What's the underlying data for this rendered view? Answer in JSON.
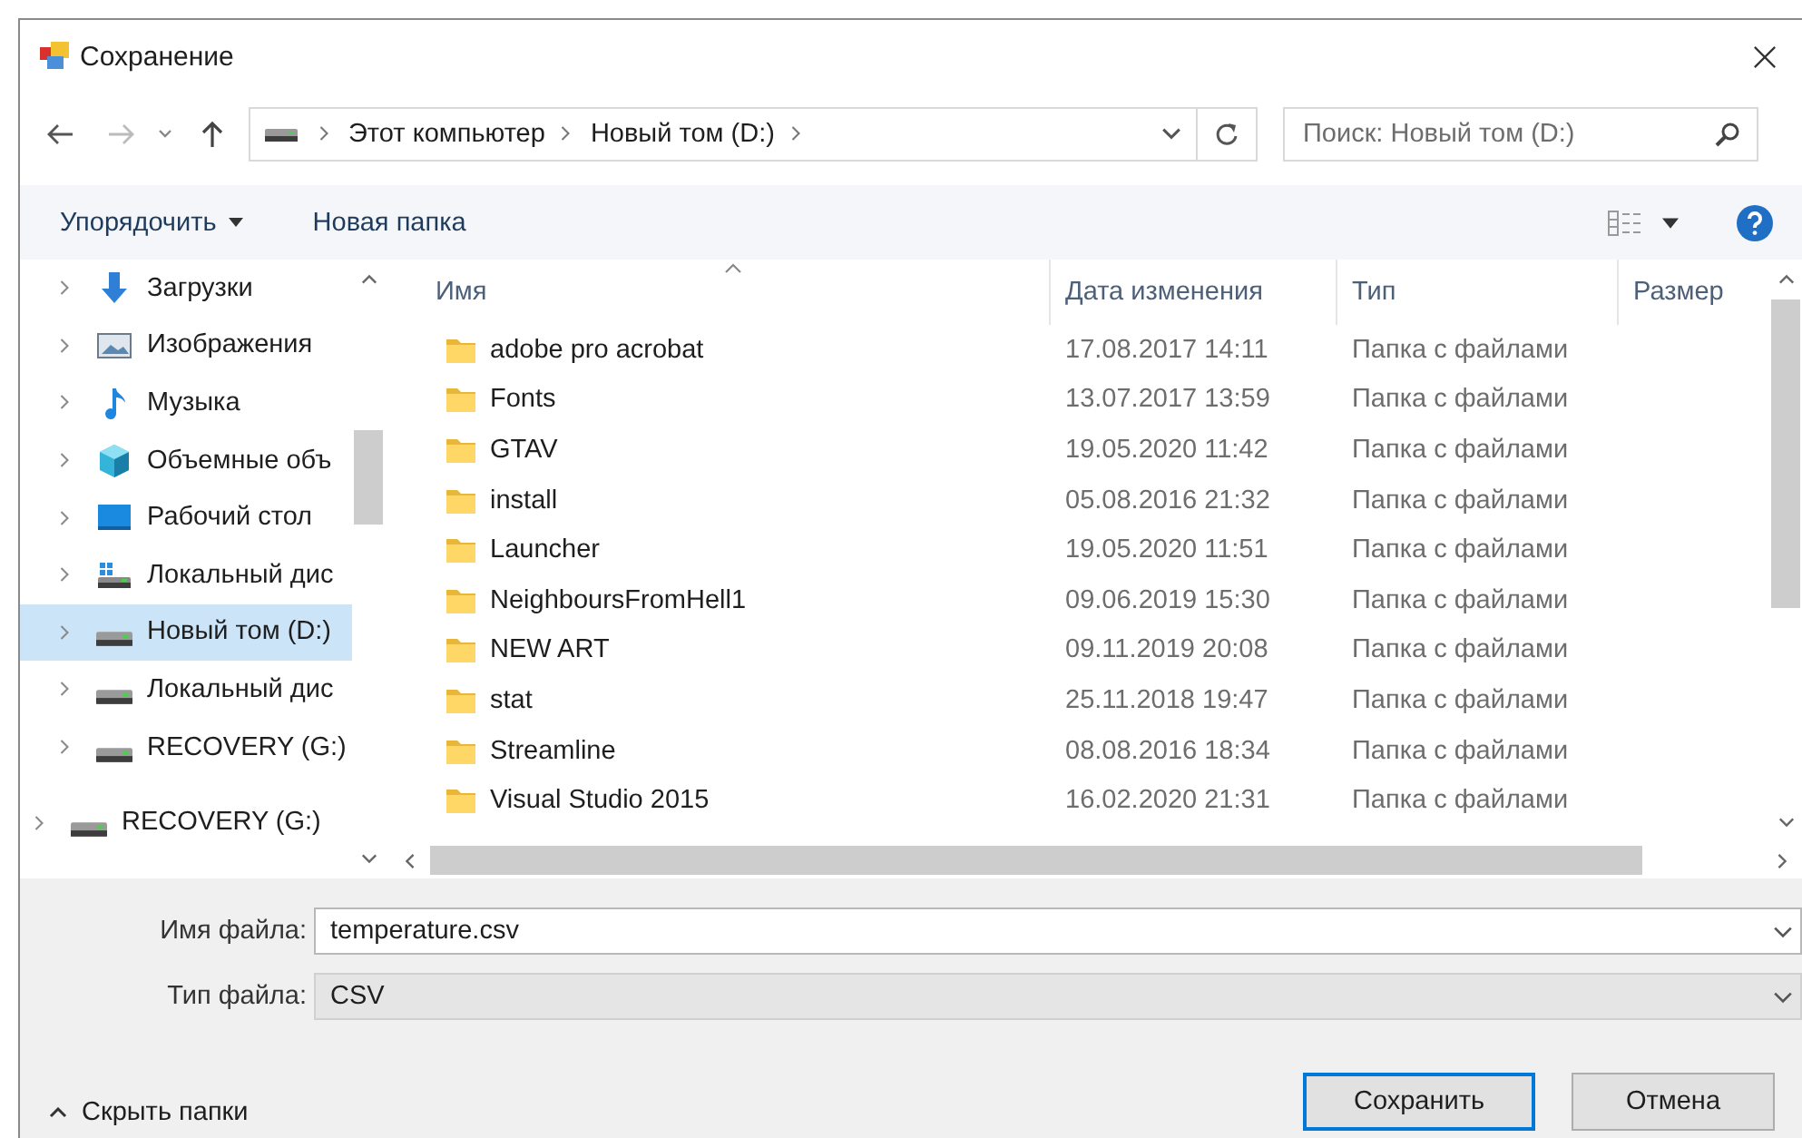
{
  "window": {
    "title": "Сохранение"
  },
  "address_bar": {
    "segments": [
      "Этот компьютер",
      "Новый том (D:)"
    ]
  },
  "search": {
    "placeholder": "Поиск: Новый том (D:)"
  },
  "toolbar": {
    "buttons": [
      {
        "label": "Упорядочить",
        "kind": "menu"
      },
      {
        "label": "Новая папка",
        "kind": "plain"
      }
    ]
  },
  "sidebar": {
    "items": [
      {
        "label": "Загрузки",
        "kind": "downloads",
        "selected": false
      },
      {
        "label": "Изображения",
        "kind": "pictures",
        "selected": false
      },
      {
        "label": "Музыка",
        "kind": "music",
        "selected": false
      },
      {
        "label": "Объемные объ",
        "kind": "objects",
        "selected": false
      },
      {
        "label": "Рабочий стол",
        "kind": "desktop",
        "selected": false
      },
      {
        "label": "Локальный дис",
        "kind": "system-drive",
        "selected": false
      },
      {
        "label": "Новый том (D:)",
        "kind": "drive",
        "selected": true
      },
      {
        "label": "Локальный дис",
        "kind": "drive",
        "selected": false
      },
      {
        "label": "RECOVERY (G:)",
        "kind": "drive",
        "selected": false
      }
    ],
    "root_items": [
      {
        "label": "RECOVERY (G:)",
        "kind": "drive",
        "selected": false
      }
    ]
  },
  "file_list": {
    "columns": [
      {
        "label": "Имя",
        "sorted": true
      },
      {
        "label": "Дата изменения",
        "sorted": false
      },
      {
        "label": "Тип",
        "sorted": false
      },
      {
        "label": "Размер",
        "sorted": false
      }
    ],
    "rows": [
      {
        "name": "adobe pro acrobat",
        "date": "17.08.2017 14:11",
        "type": "Папка с файлами"
      },
      {
        "name": "Fonts",
        "date": "13.07.2017 13:59",
        "type": "Папка с файлами"
      },
      {
        "name": "GTAV",
        "date": "19.05.2020 11:42",
        "type": "Папка с файлами"
      },
      {
        "name": "install",
        "date": "05.08.2016 21:32",
        "type": "Папка с файлами"
      },
      {
        "name": "Launcher",
        "date": "19.05.2020 11:51",
        "type": "Папка с файлами"
      },
      {
        "name": "NeighboursFromHell1",
        "date": "09.06.2019 15:30",
        "type": "Папка с файлами"
      },
      {
        "name": "NEW ART",
        "date": "09.11.2019 20:08",
        "type": "Папка с файлами"
      },
      {
        "name": "stat",
        "date": "25.11.2018 19:47",
        "type": "Папка с файлами"
      },
      {
        "name": "Streamline",
        "date": "08.08.2016 18:34",
        "type": "Папка с файлами"
      },
      {
        "name": "Visual Studio 2015",
        "date": "16.02.2020 21:31",
        "type": "Папка с файлами"
      }
    ]
  },
  "form": {
    "file_name": {
      "label": "Имя файла:",
      "value": "temperature.csv"
    },
    "file_type": {
      "label": "Тип файла:",
      "value": "CSV"
    }
  },
  "hide_folders": "Скрыть папки",
  "buttons": [
    {
      "label": "Сохранить",
      "default": true
    },
    {
      "label": "Отмена",
      "default": false
    }
  ]
}
